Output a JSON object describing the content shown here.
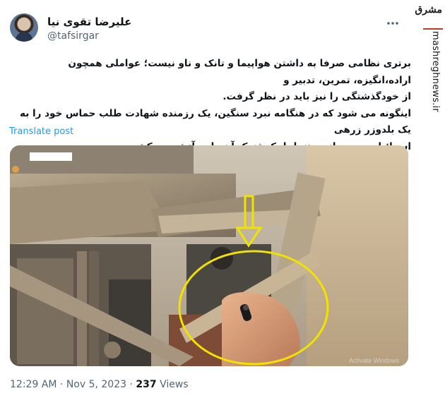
{
  "author": {
    "display_name": "علیرضا تقوی نیا",
    "handle": "@tafsirgar"
  },
  "tweet": {
    "line1": "برتری نظامی صرفا به داشتن هواپیما و تانک و ناو نیست؛ عواملی همچون اراده،انگیزه، تمرین، تدبیر و",
    "line2": "از خودگذشتگی را نیز باید در نظر گرفت.",
    "line3": "اینگونه می شود که در هنگامه نبرد سنگین، یک رزمنده شهادت طلب حماس خود را به یک بلدوزر زرهی",
    "line4": "اسرائیل می رساند و تنها با یک فندک آن را به آتش می کشد."
  },
  "translate_label": "Translate post",
  "meta": {
    "time": "12:29 AM",
    "sep1": " · ",
    "date": "Nov 5, 2023",
    "sep2": " · ",
    "views_count": "237",
    "views_label": " Views"
  },
  "media": {
    "overlay_text": "Activate Windows"
  },
  "watermark": {
    "logo": "مشرق",
    "url": "mashreghnews.ir"
  },
  "colors": {
    "accent": "#1d9bf0",
    "arrow": "#f2e200",
    "ellipse": "#f2e200"
  }
}
